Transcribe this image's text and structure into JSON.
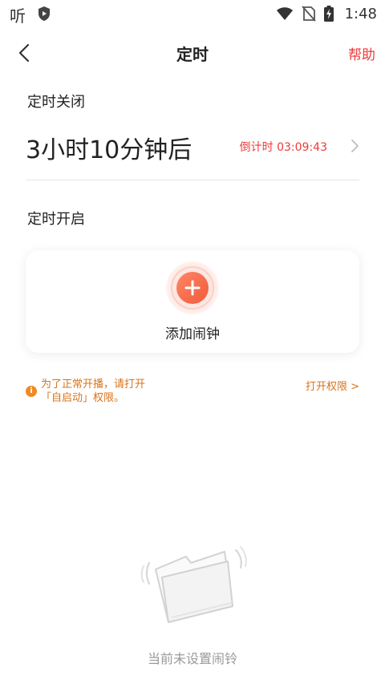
{
  "status_bar": {
    "app_glyph": "听",
    "time": "1:48",
    "icons": [
      "shield-icon",
      "wifi-icon",
      "no-sim-icon",
      "battery-charging-icon"
    ]
  },
  "nav": {
    "title": "定时",
    "help": "帮助",
    "back_icon": "chevron-left-icon"
  },
  "timer_close": {
    "title": "定时关闭",
    "value": "3小时10分钟后",
    "countdown": "倒计时 03:09:43"
  },
  "timer_open": {
    "title": "定时开启",
    "add_alarm_label": "添加闹钟"
  },
  "notice": {
    "icon_char": "i",
    "text_line1": "为了正常开播，请打开",
    "text_line2": "「自启动」权限。",
    "link": "打开权限 >"
  },
  "empty_state": {
    "text": "当前未设置闹铃",
    "icon": "empty-folder-icon"
  },
  "colors": {
    "accent_red": "#ee3a3a",
    "notice_orange": "#d9731a",
    "add_button": "#f25a3c"
  }
}
